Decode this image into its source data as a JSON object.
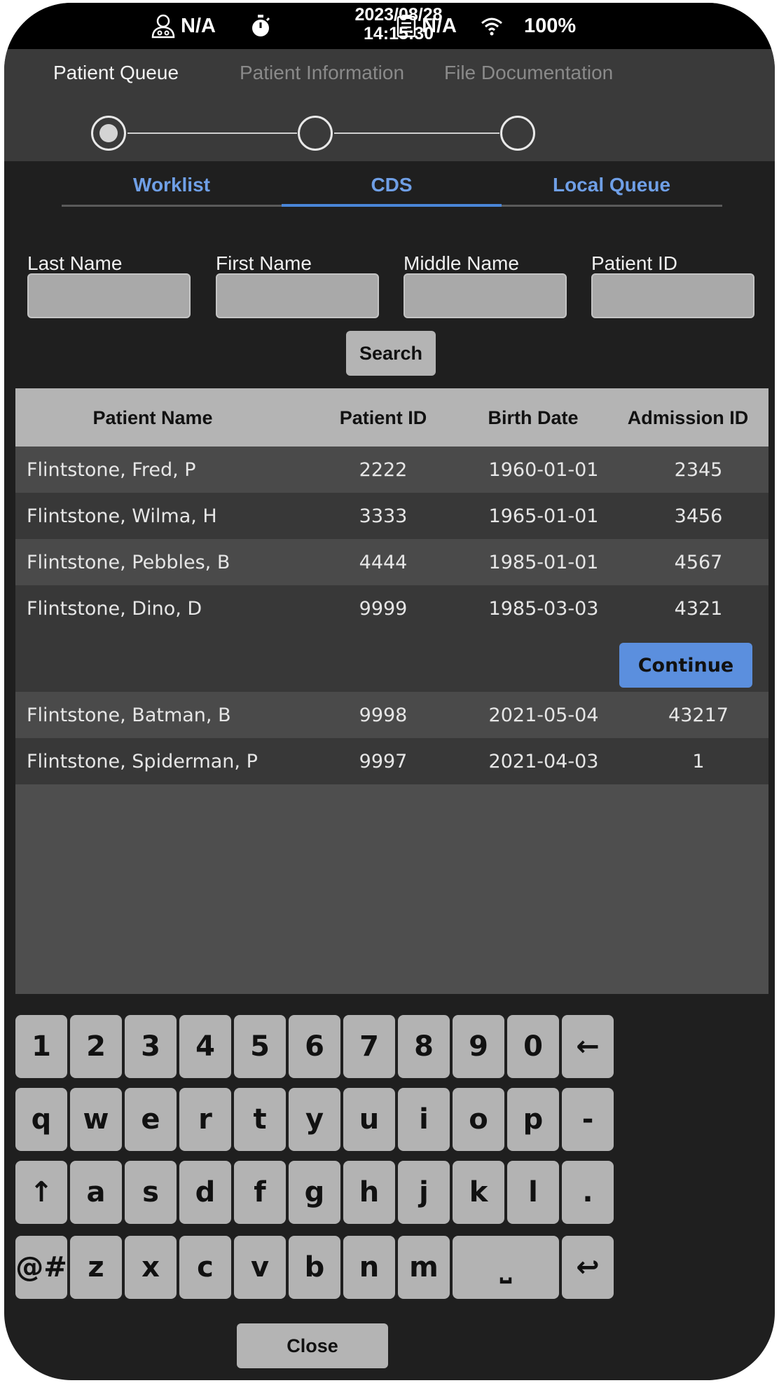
{
  "status_bar": {
    "user_value": "N/A",
    "date": "2023/08/28",
    "time": "14:15:30",
    "clipboard_value": "N/A",
    "battery": "100%"
  },
  "stepper": {
    "steps": [
      "Patient Queue",
      "Patient Information",
      "File Documentation"
    ],
    "active_index": 0
  },
  "tabs": {
    "items": [
      "Worklist",
      "CDS",
      "Local Queue"
    ],
    "active_index": 1
  },
  "search": {
    "labels": [
      "Last Name",
      "First Name",
      "Middle Name",
      "Patient ID"
    ],
    "values": [
      "",
      "",
      "",
      ""
    ],
    "button_label": "Search"
  },
  "table": {
    "headers": [
      "Patient Name",
      "Patient ID",
      "Birth Date",
      "Admission ID"
    ],
    "rows_top": [
      [
        "Flintstone, Fred, P",
        "2222",
        "1960-01-01",
        "2345"
      ],
      [
        "Flintstone, Wilma, H",
        "3333",
        "1965-01-01",
        "3456"
      ],
      [
        "Flintstone, Pebbles, B",
        "4444",
        "1985-01-01",
        "4567"
      ],
      [
        "Flintstone, Dino, D",
        "9999",
        "1985-03-03",
        "4321"
      ]
    ],
    "continue_label": "Continue",
    "rows_bottom": [
      [
        "Flintstone, Batman, B",
        "9998",
        "2021-05-04",
        "43217"
      ],
      [
        "Flintstone, Spiderman, P",
        "9997",
        "2021-04-03",
        "1"
      ]
    ]
  },
  "keyboard": {
    "row1": [
      "1",
      "2",
      "3",
      "4",
      "5",
      "6",
      "7",
      "8",
      "9",
      "0",
      "←"
    ],
    "row2": [
      "q",
      "w",
      "e",
      "r",
      "t",
      "y",
      "u",
      "i",
      "o",
      "p",
      "-"
    ],
    "row3": [
      "↑",
      "a",
      "s",
      "d",
      "f",
      "g",
      "h",
      "j",
      "k",
      "l",
      "."
    ],
    "row4": [
      "@#",
      "z",
      "x",
      "c",
      "v",
      "b",
      "n",
      "m",
      "⎵",
      "↩"
    ]
  },
  "close_label": "Close",
  "colors": {
    "accent": "#5b8fde",
    "tab_text": "#6f9fe6",
    "background": "#1f1f1f"
  }
}
